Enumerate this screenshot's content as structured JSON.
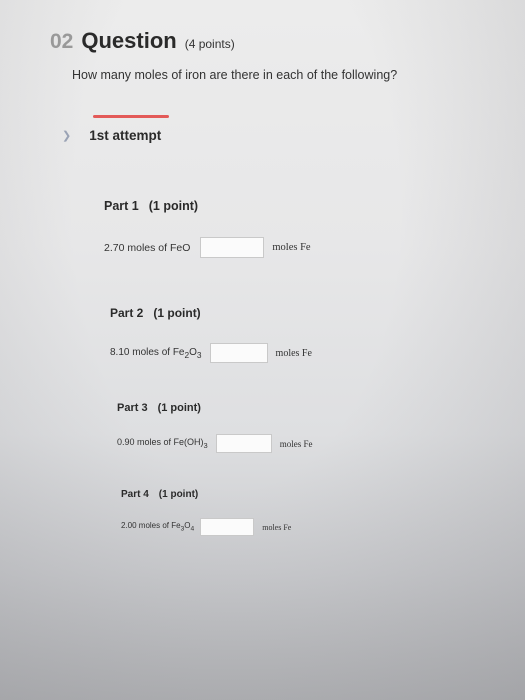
{
  "question": {
    "number": "02",
    "word": "Question",
    "points": "(4 points)",
    "text": "How many moles of iron are there in each of the following?"
  },
  "attempt": {
    "label": "1st attempt"
  },
  "parts": [
    {
      "title": "Part 1",
      "points": "(1 point)",
      "amount": "2.70 moles of ",
      "formula_html": "FeO",
      "input_value": "",
      "unit": "moles Fe"
    },
    {
      "title": "Part 2",
      "points": "(1 point)",
      "amount": "8.10 moles of ",
      "formula_html": "Fe<sub>2</sub>O<sub>3</sub>",
      "input_value": "",
      "unit": "moles Fe"
    },
    {
      "title": "Part 3",
      "points": "(1 point)",
      "amount": "0.90 moles of ",
      "formula_html": "Fe(OH)<sub>3</sub>",
      "input_value": "",
      "unit": "moles Fe"
    },
    {
      "title": "Part 4",
      "points": "(1 point)",
      "amount": "2.00 moles of ",
      "formula_html": "Fe<sub>3</sub>O<sub>4</sub>",
      "input_value": "",
      "unit": "moles Fe"
    }
  ],
  "colors": {
    "accent_red": "#e35a58",
    "chevron": "#9aa3b5"
  }
}
